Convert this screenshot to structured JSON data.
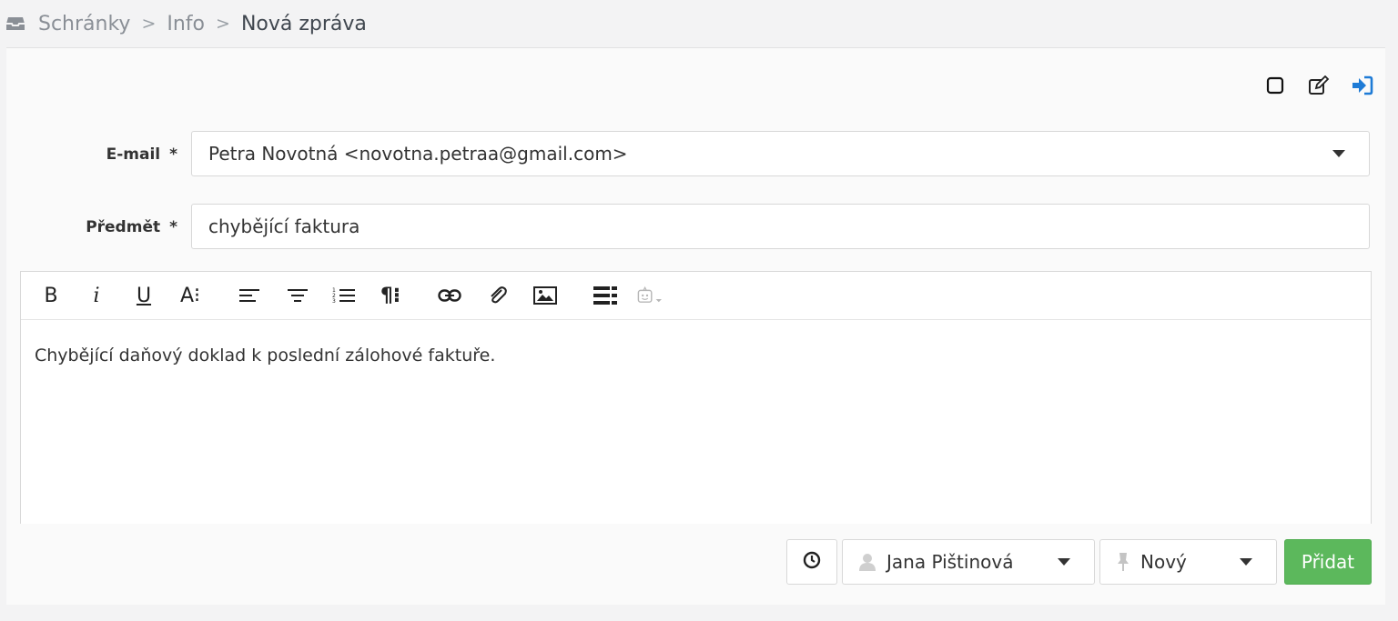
{
  "breadcrumb": {
    "items": [
      "Schránky",
      "Info"
    ],
    "separator": ">",
    "current": "Nová zpráva"
  },
  "form": {
    "email": {
      "label": "E-mail",
      "required_mark": "*",
      "value": "Petra Novotná <novotna.petraa@gmail.com>"
    },
    "subject": {
      "label": "Předmět",
      "required_mark": "*",
      "value": "chybějící faktura"
    }
  },
  "editor": {
    "toolbar": {
      "bold": "B",
      "italic": "i",
      "underline": "U",
      "font_size": "A⁝",
      "paragraph": "¶⁝"
    },
    "body_text": "Chybějící daňový doklad k poslední zálohové faktuře."
  },
  "bottom": {
    "assignee": "Jana Pištinová",
    "status": "Nový",
    "submit_label": "Přidat"
  },
  "colors": {
    "accent_blue": "#1e7bd6",
    "submit_green": "#5cb85c"
  }
}
